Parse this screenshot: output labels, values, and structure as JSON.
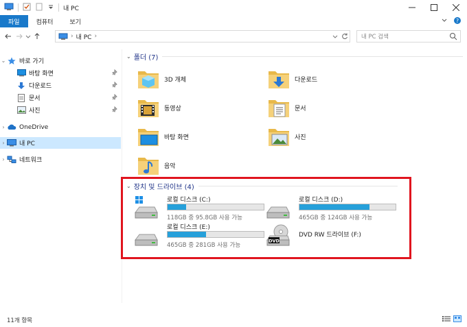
{
  "window": {
    "title": "내 PC"
  },
  "ribbon": {
    "tabs": [
      "파일",
      "컴퓨터",
      "보기"
    ]
  },
  "address": {
    "path_root": "내 PC"
  },
  "search": {
    "placeholder": "내 PC 검색"
  },
  "sidebar": {
    "quick_access": "바로 가기",
    "quick_items": [
      "바탕 화면",
      "다운로드",
      "문서",
      "사진"
    ],
    "onedrive": "OneDrive",
    "this_pc": "내 PC",
    "network": "네트워크"
  },
  "folders": {
    "header": "폴더 (7)",
    "items": [
      "3D 개체",
      "다운로드",
      "동영상",
      "문서",
      "바탕 화면",
      "사진",
      "음악"
    ]
  },
  "drives": {
    "header": "장치 및 드라이브 (4)",
    "items": [
      {
        "name": "로컬 디스크 (C:)",
        "free": "118GB 중 95.8GB 사용 가능",
        "used_fraction": 0.19
      },
      {
        "name": "로컬 디스크 (D:)",
        "free": "465GB 중 124GB 사용 가능",
        "used_fraction": 0.73
      },
      {
        "name": "로컬 디스크 (E:)",
        "free": "465GB 중 281GB 사용 가능",
        "used_fraction": 0.4
      },
      {
        "name": "DVD RW 드라이브 (F:)",
        "icon_text": "DVD"
      }
    ]
  },
  "status": {
    "count": "11개 항목"
  },
  "colors": {
    "accent": "#1979ca",
    "selection": "#cce8ff",
    "highlight_border": "#e0141e",
    "bar_fill": "#26a0da",
    "group_header": "#1e3287"
  }
}
